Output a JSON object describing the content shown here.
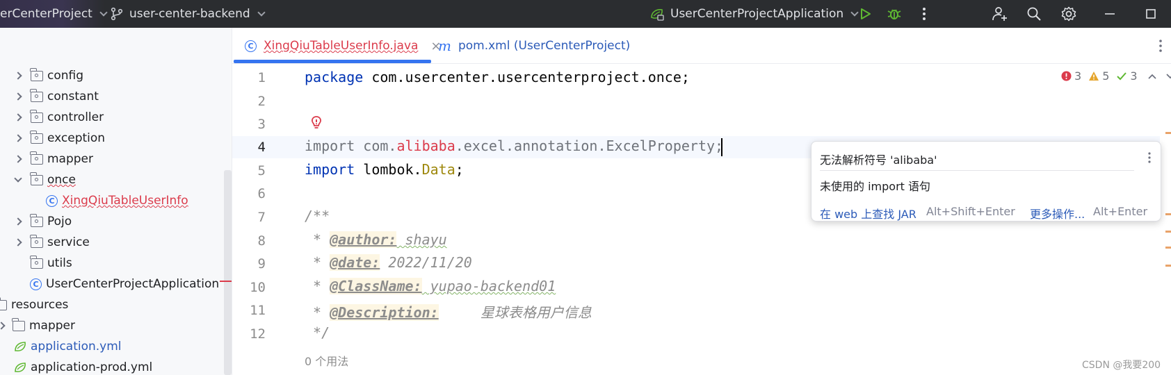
{
  "titlebar": {
    "project": "erCenterProject",
    "branch": "user-center-backend",
    "run_config": "UserCenterProjectApplication"
  },
  "sidebar": {
    "items": [
      {
        "label": "config",
        "type": "folder"
      },
      {
        "label": "constant",
        "type": "folder"
      },
      {
        "label": "controller",
        "type": "folder"
      },
      {
        "label": "exception",
        "type": "folder"
      },
      {
        "label": "mapper",
        "type": "folder"
      },
      {
        "label": "once",
        "type": "folder-open"
      },
      {
        "label": "XingQiuTableUserInfo",
        "type": "class-error"
      },
      {
        "label": "Pojo",
        "type": "folder"
      },
      {
        "label": "service",
        "type": "folder"
      },
      {
        "label": "utils",
        "type": "folder-leaf"
      },
      {
        "label": "UserCenterProjectApplication",
        "type": "spring-class"
      },
      {
        "label": "resources",
        "type": "resources"
      },
      {
        "label": "mapper",
        "type": "folder"
      },
      {
        "label": "application.yml",
        "type": "yml-modified"
      },
      {
        "label": "application-prod.yml",
        "type": "yml"
      }
    ]
  },
  "tabs": [
    {
      "label": "XingQiuTableUserInfo.java",
      "active": true
    },
    {
      "label": "pom.xml (UserCenterProject)",
      "active": false
    }
  ],
  "inspections": {
    "errors": "3",
    "warnings": "5",
    "ok": "3"
  },
  "editor": {
    "line_numbers": [
      "1",
      "2",
      "3",
      "4",
      "5",
      "6",
      "7",
      "8",
      "9",
      "10",
      "11",
      "12"
    ],
    "line1": {
      "kw": "package",
      "rest": " com.usercenter.usercenterproject.once;"
    },
    "line4": {
      "kw": "import",
      "a": " com.",
      "err": "alibaba",
      "b": ".excel.annotation.ExcelProperty;"
    },
    "line5": {
      "kw": "import",
      "a": " lombok.",
      "ann": "Data",
      "b": ";"
    },
    "line7": "/**",
    "line8": {
      "star": " * ",
      "tag": "@author:",
      "val": " shayu"
    },
    "line9": {
      "star": " * ",
      "tag": "@date:",
      "val": " 2022/11/20"
    },
    "line10": {
      "star": " * ",
      "tag": "@ClassName:",
      "val": " yupao-backend01"
    },
    "line11": {
      "star": " * ",
      "tag": "@Description:",
      "val": "     星球表格用户信息"
    },
    "line12": " */",
    "usages": "0 个用法"
  },
  "popup": {
    "title": "无法解析符号 'alibaba'",
    "message": "未使用的 import 语句",
    "action1": "在 web 上查找 JAR",
    "action1_shortcut": "Alt+Shift+Enter",
    "action2": "更多操作...",
    "action2_shortcut": "Alt+Enter"
  },
  "watermark": "CSDN @我要200",
  "colors": {
    "accent": "#3574f0",
    "error": "#db3b4b",
    "titlebar": "#2b2d30"
  }
}
